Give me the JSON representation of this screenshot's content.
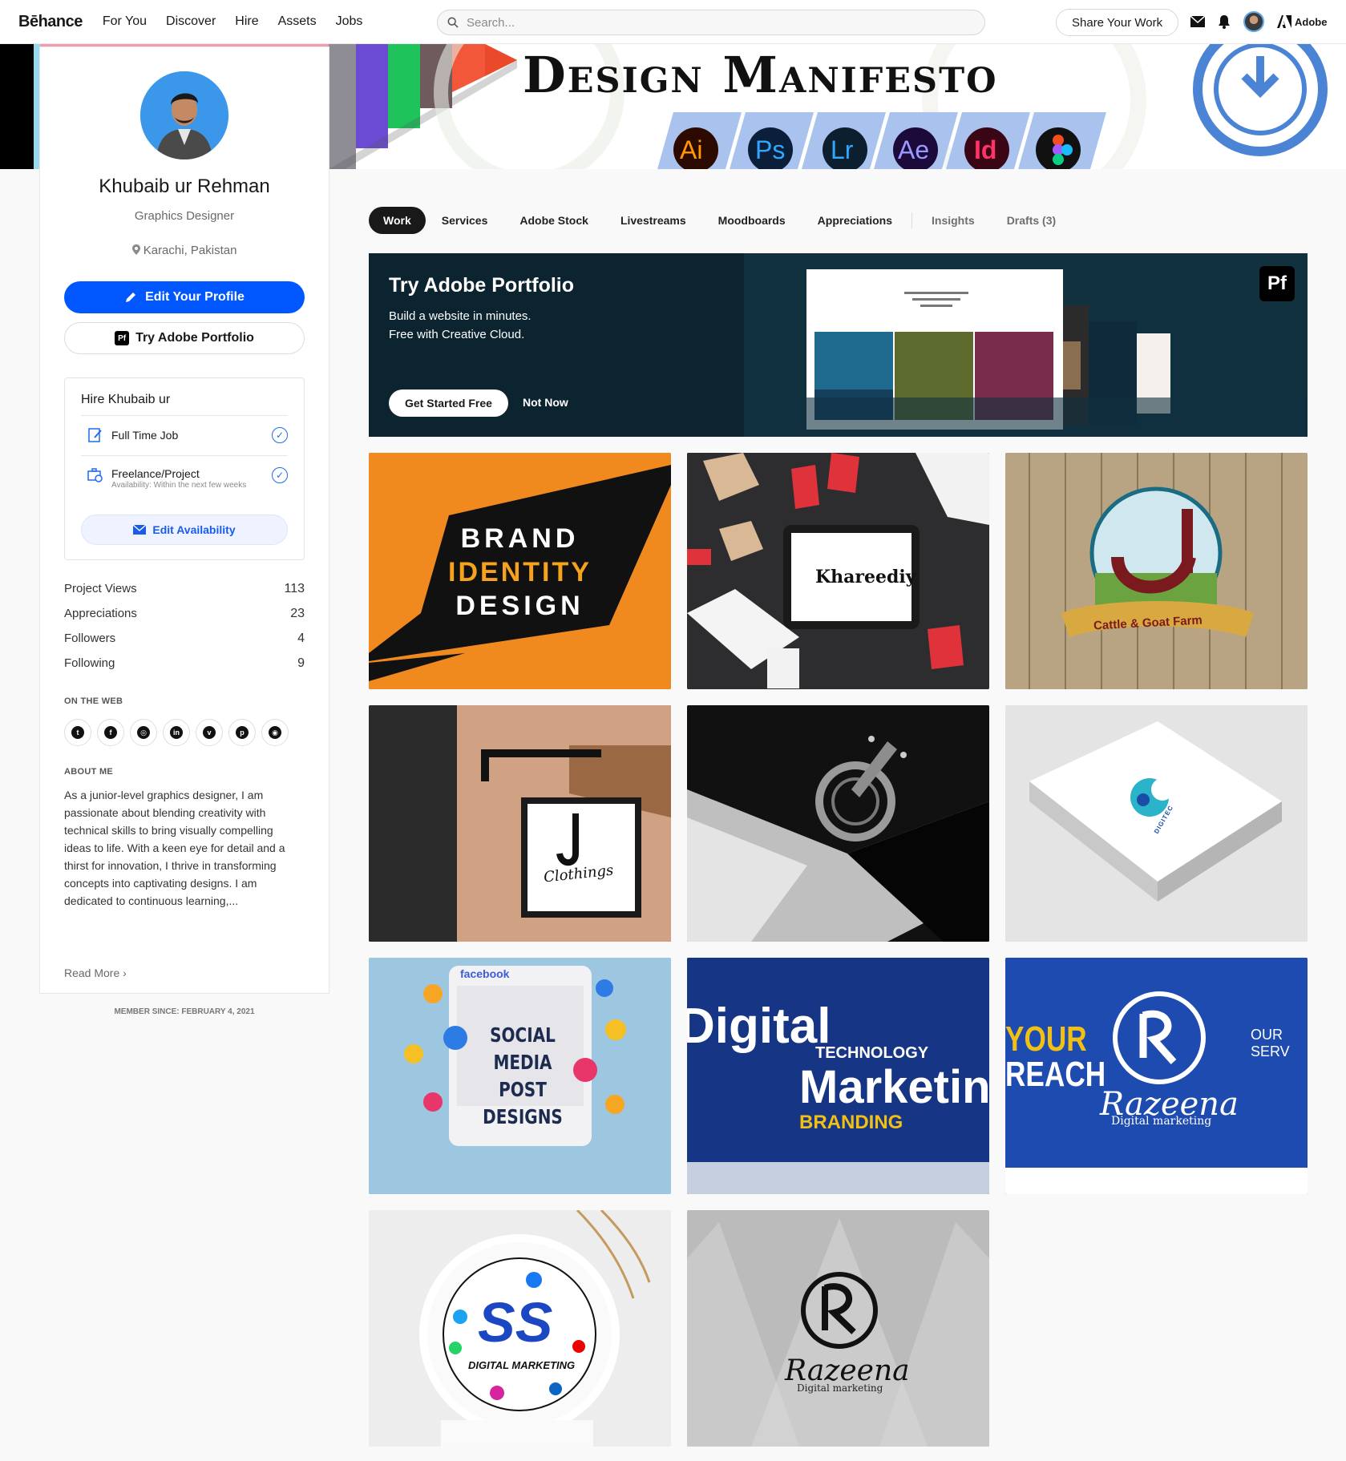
{
  "nav": {
    "logo": "Bēhance",
    "links": [
      "For You",
      "Discover",
      "Hire",
      "Assets",
      "Jobs"
    ],
    "search_placeholder": "Search...",
    "share_label": "Share Your Work",
    "adobe_label": "Adobe"
  },
  "banner": {
    "title": "Design Manifesto",
    "app_icons": [
      "Ai",
      "Ps",
      "Lr",
      "Ae",
      "Id"
    ]
  },
  "profile": {
    "name": "Khubaib ur Rehman",
    "title": "Graphics Designer",
    "location": "Karachi, Pakistan",
    "edit_label": "Edit Your Profile",
    "portfolio_label": "Try Adobe Portfolio",
    "hire": {
      "title": "Hire Khubaib ur",
      "full_time": "Full Time Job",
      "freelance": "Freelance/Project",
      "availability": "Availability: Within the next few weeks",
      "edit_availability": "Edit Availability"
    },
    "stats": [
      {
        "label": "Project Views",
        "value": "113"
      },
      {
        "label": "Appreciations",
        "value": "23"
      },
      {
        "label": "Followers",
        "value": "4"
      },
      {
        "label": "Following",
        "value": "9"
      }
    ],
    "on_the_web": "ON THE WEB",
    "socials": [
      "twitter-icon",
      "facebook-icon",
      "dribbble-icon",
      "linkedin-icon",
      "vimeo-icon",
      "pinterest-icon",
      "instagram-icon"
    ],
    "about_label": "ABOUT ME",
    "about": "As a junior-level graphics designer, I am passionate about blending creativity with technical skills to bring visually compelling ideas to life. With a keen eye for detail and a thirst for innovation, I thrive in transforming concepts into captivating designs. I am dedicated to continuous learning,...",
    "read_more": "Read More",
    "member_since": "MEMBER SINCE: FEBRUARY 4, 2021"
  },
  "tabs": [
    "Work",
    "Services",
    "Adobe Stock",
    "Livestreams",
    "Moodboards",
    "Appreciations",
    "Insights",
    "Drafts (3)"
  ],
  "promo": {
    "title": "Try Adobe Portfolio",
    "subtitle": "Build a website in minutes.\nFree with Creative Cloud.",
    "cta": "Get Started Free",
    "dismiss": "Not Now",
    "badge": "Pf"
  },
  "projects": [
    {
      "lines": [
        "BRAND",
        "IDENTITY",
        "DESIGN"
      ]
    },
    {
      "text": "Khareediy"
    },
    {
      "text": "Cattle & Goat Farm"
    },
    {
      "text": "Clothings"
    },
    {
      "text": ""
    },
    {
      "text": "DIGITEC"
    },
    {
      "brand": "facebook",
      "lines": [
        "SOCIAL MEDIA",
        "POST DESIGNS"
      ]
    },
    {
      "lines": [
        "Digital",
        "Marketing",
        "BRANDING",
        "TECHNOLOGY"
      ]
    },
    {
      "lines": [
        "YOUR",
        "REACH",
        "Razeena",
        "Digital marketing",
        "OUR SERV"
      ]
    },
    {
      "lines": [
        "SS",
        "DIGITAL MARKETING"
      ]
    },
    {
      "lines": [
        "Razeena",
        "Digital marketing"
      ]
    }
  ]
}
